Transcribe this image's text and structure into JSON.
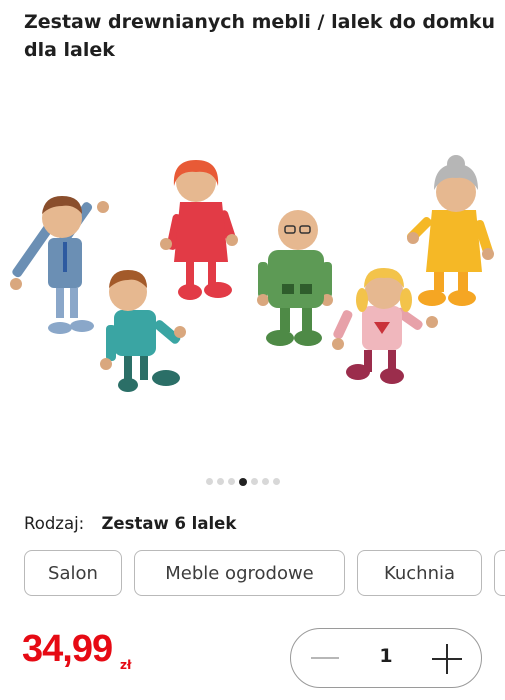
{
  "product": {
    "title": "Zestaw drewnianych mebli / lalek do domku dla lalek"
  },
  "gallery": {
    "image_icon": "doll-family-product-image",
    "dot_count": 6,
    "active_dot": 3
  },
  "variant": {
    "label": "Rodzaj:",
    "value": "Zestaw 6 lalek",
    "options": [
      "Salon",
      "Meble ogrodowe",
      "Kuchnia"
    ]
  },
  "price": {
    "amount": "34,99",
    "currency": "zł",
    "color": "#e60a14"
  },
  "quantity": {
    "value": "1",
    "minus_icon": "minus-icon",
    "plus_icon": "plus-icon"
  }
}
